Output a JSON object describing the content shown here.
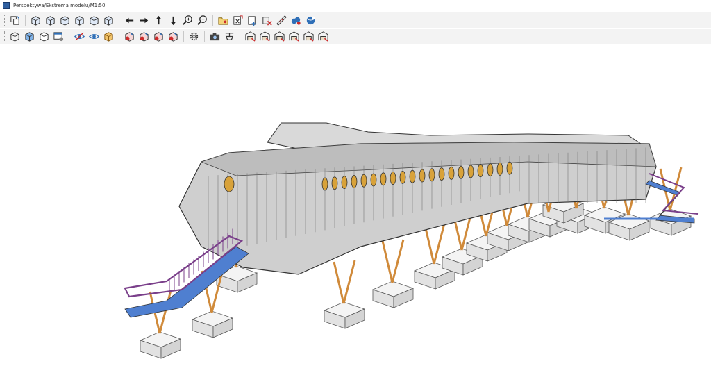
{
  "window": {
    "title": "Perspektywa/Ekstrema modelu/M1:50"
  },
  "toolbar_top": {
    "groups": [
      [
        "rotate-view-icon"
      ],
      [
        "cube-iso-1-icon",
        "cube-iso-2-icon",
        "cube-iso-3-icon",
        "cube-iso-4-icon",
        "cube-iso-5-icon",
        "cube-iso-6-icon"
      ],
      [
        "arrow-left-icon",
        "arrow-right-icon",
        "arrow-up-icon",
        "arrow-down-icon",
        "zoom-in-icon",
        "zoom-out-icon"
      ],
      [
        "open-model-icon",
        "export-x-icon",
        "add-model-icon",
        "delete-model-icon",
        "measure-icon",
        "cloud-model-icon",
        "globe-icon"
      ]
    ]
  },
  "toolbar_second": {
    "groups": [
      [
        "wireframe-cube-icon",
        "solid-cube-icon",
        "hidden-cube-icon",
        "view-settings-icon"
      ],
      [
        "hide-icon",
        "show-icon",
        "select-object-icon"
      ],
      [
        "filter-red-1-icon",
        "filter-red-2-icon",
        "filter-red-3-icon",
        "filter-red-4-icon"
      ],
      [
        "gear-icon"
      ],
      [
        "camera-icon",
        "drone-icon"
      ],
      [
        "structure-1-icon",
        "structure-2-icon",
        "structure-3-icon",
        "structure-4-icon",
        "structure-5-icon",
        "structure-6-icon"
      ]
    ]
  },
  "colors": {
    "accent": "#2f6fb7",
    "red": "#cc2a2a",
    "toolbar_bg": "#f3f3f3",
    "steel": "#5a5a5a",
    "stair_blue": "#4f7fd0",
    "stair_purple": "#7a3f8a",
    "leg_orange": "#d08a3a"
  },
  "viewport": {
    "description_view": "3D perspective model view"
  }
}
